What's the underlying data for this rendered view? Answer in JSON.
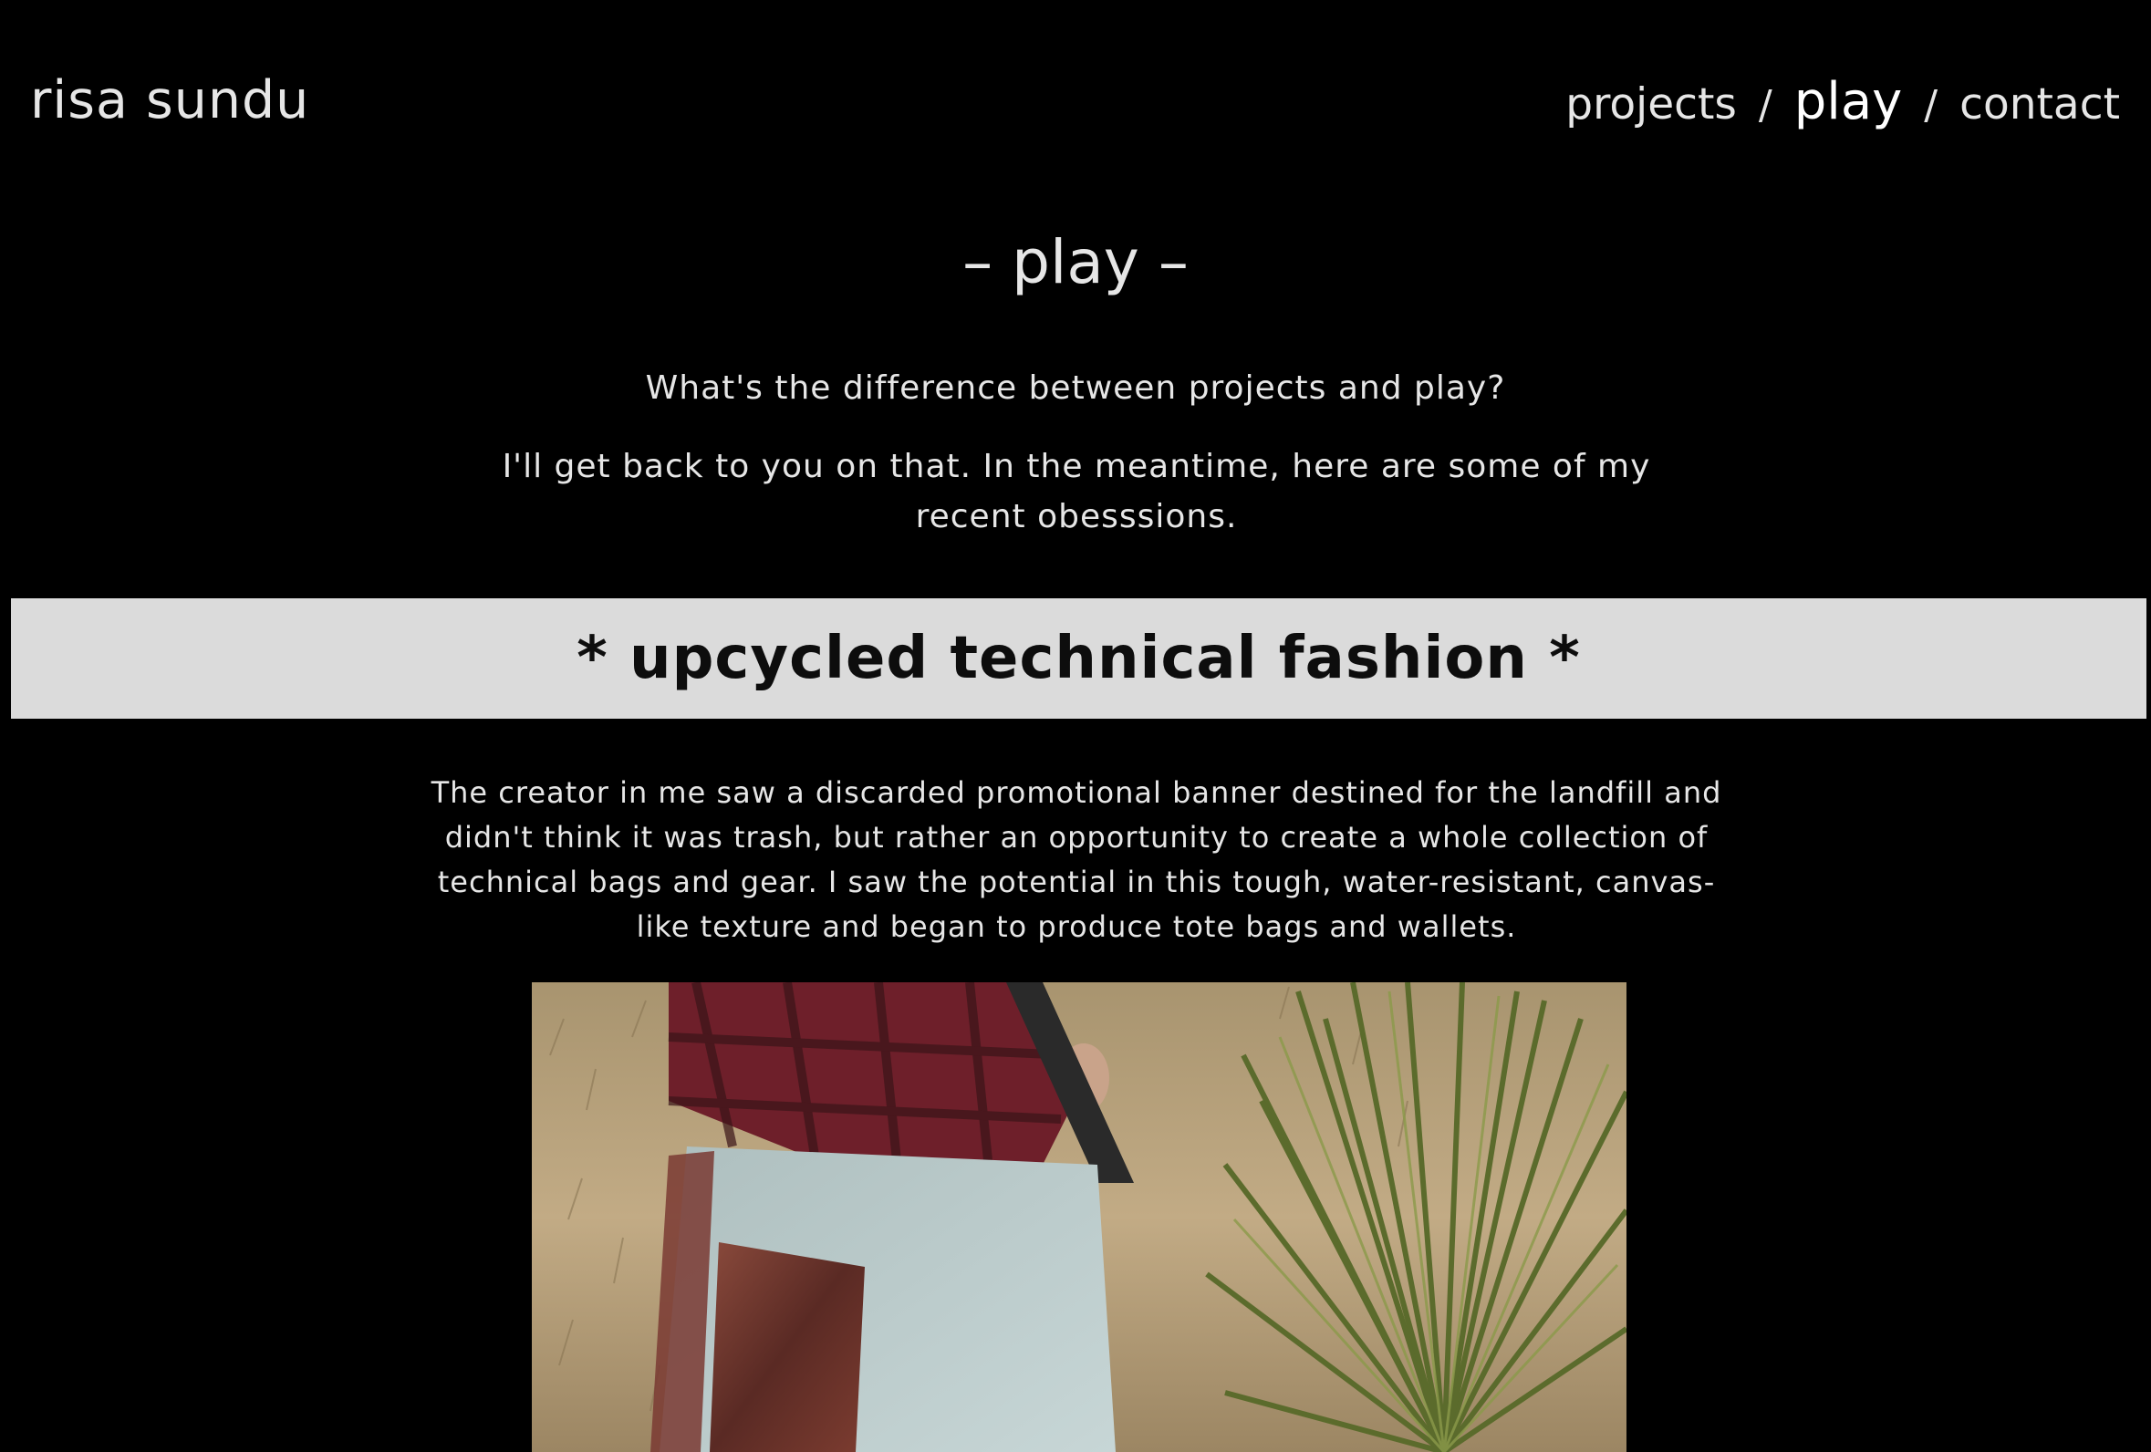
{
  "header": {
    "site_title": "risa sundu",
    "nav": [
      {
        "label": "projects",
        "active": false
      },
      {
        "label": "play",
        "active": true
      },
      {
        "label": "contact",
        "active": false
      }
    ],
    "separator": "/"
  },
  "main": {
    "section_title": "– play –",
    "intro_question": "What's the difference between projects and play?",
    "intro_answer": "I'll get back to you on that. In the meantime, here are some of my recent obesssions.",
    "project": {
      "title": "* upcycled technical fashion *",
      "description": "The creator in me saw a discarded promotional banner destined for the landfill and didn't think it was trash, but rather an opportunity to create a whole collection of technical bags and gear. I saw the potential in this tough, water-resistant, canvas-like texture and began to produce tote bags and wallets."
    }
  },
  "colors": {
    "background": "#000000",
    "text": "#e6e6e6",
    "banner_background": "#dbdbdb",
    "banner_text": "#0d0d0d"
  }
}
